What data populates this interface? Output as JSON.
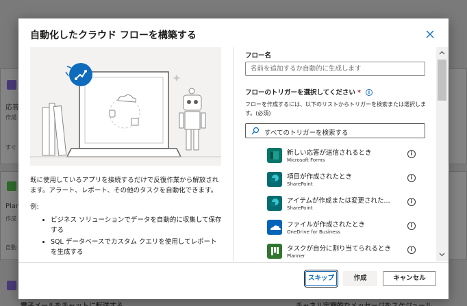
{
  "background": {
    "cards": [
      {
        "title": "応答",
        "sub": "作成",
        "foot": "すぐ"
      },
      {
        "title": "Plan",
        "sub": "作成",
        "foot": "自動"
      }
    ],
    "bottom_left": "電子メールをチャットに転送する",
    "bottom_right": "チャネル定期的なメッセージをスケジュール"
  },
  "dialog": {
    "title": "自動化したクラウド フローを構築する",
    "description": "既に使用しているアプリを接続するだけで反復作業から解放されます。アラート、レポート、その他のタスクを自動化できます。",
    "example_label": "例:",
    "examples": [
      "ビジネス ソリューションでデータを自動的に収集して保存する",
      "SQL データベースでカスタム クエリを使用してレポートを生成する"
    ],
    "flow_name": {
      "label": "フロー名",
      "placeholder": "名前を追加するか自動的に生成します"
    },
    "trigger": {
      "label": "フローのトリガーを選択してください",
      "required_mark": "*",
      "help": "フローを作成するには、以下のリストからトリガーを検索または選択します。(必須)",
      "search_placeholder": "すべてのトリガーを検索する",
      "items": [
        {
          "name": "新しい応答が送信されるとき",
          "service": "Microsoft Forms",
          "color": "#077568"
        },
        {
          "name": "項目が作成されたとき",
          "service": "SharePoint",
          "color": "#036c70"
        },
        {
          "name": "アイテムが作成または変更された...",
          "service": "SharePoint",
          "color": "#036c70"
        },
        {
          "name": "ファイルが作成されたとき",
          "service": "OneDrive for Business",
          "color": "#0364b8"
        },
        {
          "name": "タスクが自分に割り当てられるとき",
          "service": "Planner",
          "color": "#31752f"
        }
      ]
    },
    "buttons": {
      "skip": "スキップ",
      "create": "作成",
      "cancel": "キャンセル"
    },
    "colors": {
      "accent": "#0f6cbd",
      "required": "#a4262c"
    }
  }
}
